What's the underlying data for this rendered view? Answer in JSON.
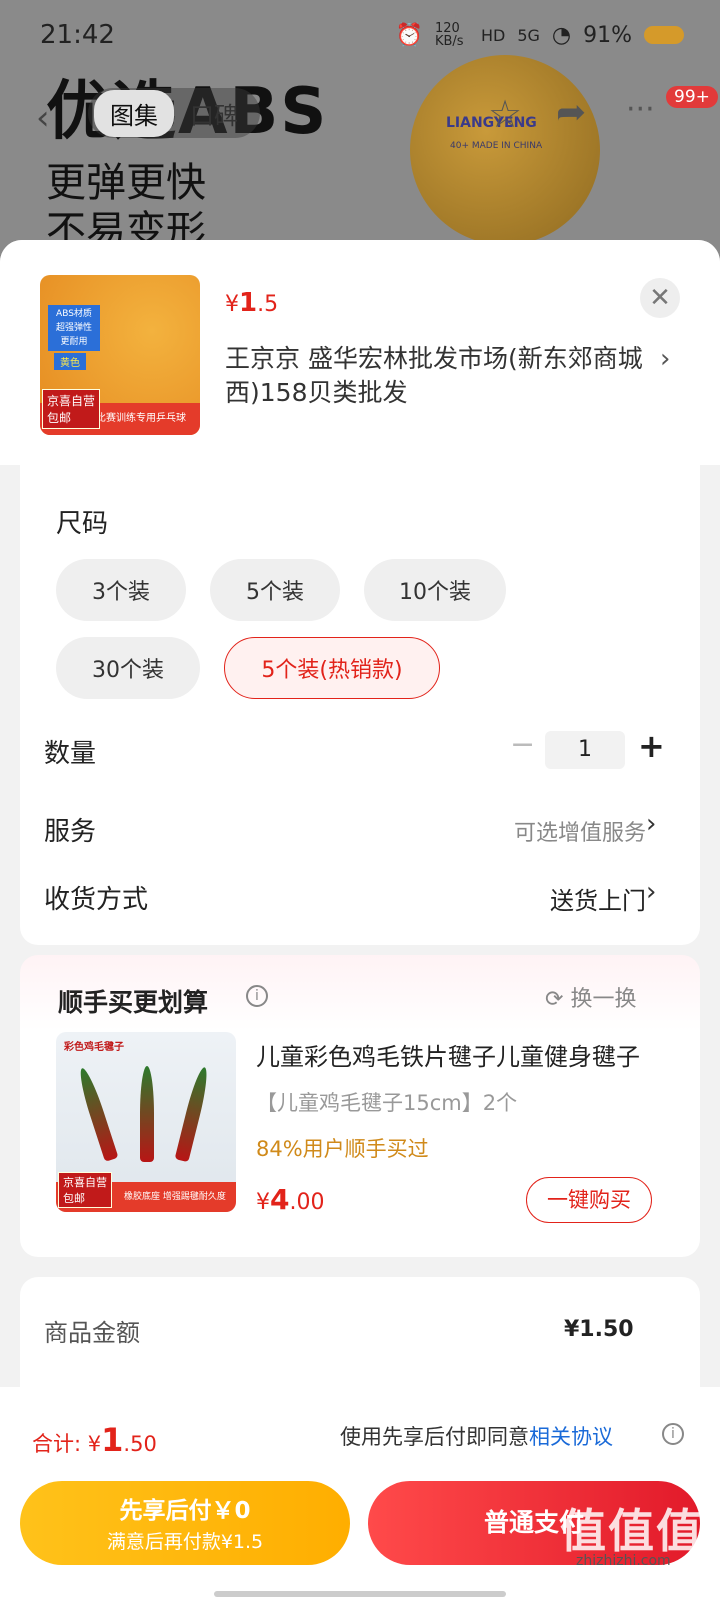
{
  "status_bar": {
    "time": "21:42",
    "net_speed": "120 KB/s",
    "hd": "HD",
    "signal": "5G",
    "battery": "91%"
  },
  "background": {
    "tabs": [
      "图集",
      "口碑"
    ],
    "hero_line1": "优选ABS",
    "hero_line2": "更弹更快",
    "hero_line3": "不易变形",
    "ball_brand": "LIANGYENG",
    "ball_mark": "40+ MADE IN CHINA",
    "badge": "99+"
  },
  "sheet": {
    "product": {
      "price_symbol": "¥",
      "price_int": "1",
      "price_dec": ".5",
      "store": "王京京  盛华宏林批发市场(新东郊商城西)158贝类批发",
      "thumb_tags": [
        "ABS材质",
        "超强弹性",
        "更耐用"
      ],
      "thumb_color": "黄色",
      "thumb_footer": "比赛训练专用乒乓球",
      "thumb_badge1": "京喜自营",
      "thumb_badge2": "包邮"
    },
    "size": {
      "title": "尺码",
      "options": [
        "3个装",
        "5个装",
        "10个装",
        "30个装",
        "5个装(热销款)"
      ],
      "selected": 4
    },
    "quantity": {
      "label": "数量",
      "minus": "−",
      "value": "1",
      "plus": "+"
    },
    "service": {
      "label": "服务",
      "value": "可选增值服务"
    },
    "delivery": {
      "label": "收货方式",
      "value": "送货上门"
    },
    "recommend": {
      "title": "顺手买更划算",
      "refresh": "换一换",
      "img_label": "彩色鸡毛毽子",
      "img_footer": "橡胶底座 增强踢毽耐久度",
      "img_badge1": "京喜自营",
      "img_badge2": "包邮",
      "name": "儿童彩色鸡毛铁片毽子儿童健身毽子",
      "spec": "【儿童鸡毛毽子15cm】2个",
      "pct": "84%用户顺手买过",
      "price_symbol": "¥",
      "price_int": "4",
      ".price_dec": ".00",
      "price_dec": ".00",
      "buy": "一键购买"
    },
    "amount": {
      "label": "商品金额",
      "value": "¥1.50"
    }
  },
  "bottom": {
    "total_label": "合计:",
    "total_symbol": "¥",
    "total_int": "1",
    ".total_dec": ".50",
    "total_dec": ".50",
    "agree_text": "使用先享后付即同意",
    "agree_link": "相关协议",
    "pay_later_l1": "先享后付￥0",
    "pay_later_l2": "满意后再付款¥1.5",
    "pay_normal": "普通支付",
    "watermark": "值值值",
    "watermark_url": "zhizhizhi.com"
  },
  "colors": {
    "accent": "#e2231a",
    "gold": "#ffb800",
    "link": "#1a6ad8"
  }
}
